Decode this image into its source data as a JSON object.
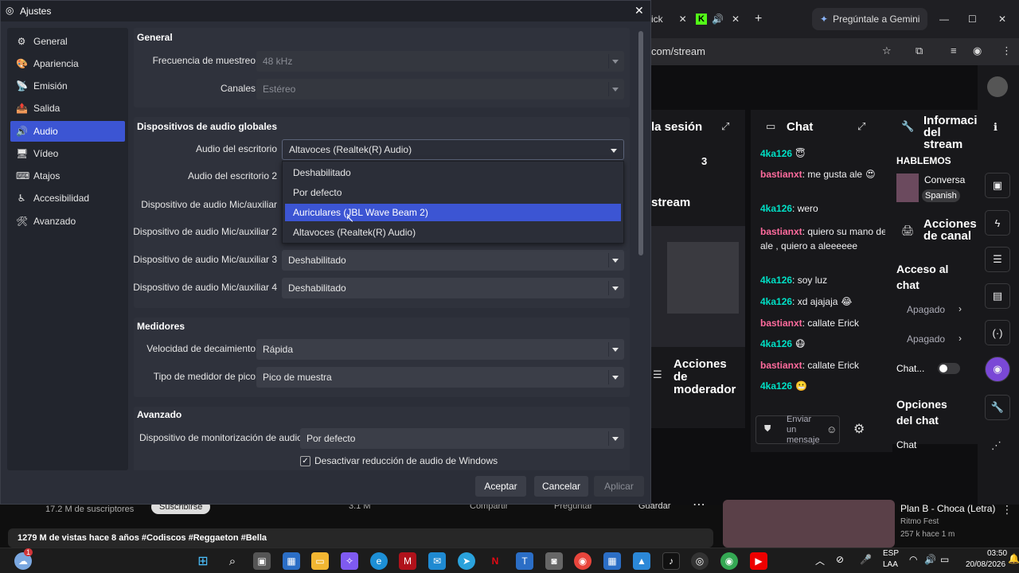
{
  "browser": {
    "tab_partial": "ick",
    "tab_gemini": "Pregúntale a Gemini",
    "address": "com/stream"
  },
  "twitch": {
    "session_title": "la sesión",
    "session_number": "3",
    "stream_label": "stream",
    "mod_actions": "Acciones de moderador",
    "chat_title": "Chat",
    "chat_messages": [
      {
        "user": "4ka126",
        "text": "",
        "emote": "😇"
      },
      {
        "user": "bastianxt",
        "text": ": me gusta ale",
        "emote": "😍"
      },
      {
        "user": "4ka126",
        "text": ": wero",
        "emote": ""
      },
      {
        "user": "bastianxt",
        "text": ": quiero su mano de ale , quiero a aleeeeee",
        "emote": ""
      },
      {
        "user": "4ka126",
        "text": ": soy luz",
        "emote": ""
      },
      {
        "user": "4ka126",
        "text": ": xd ajajaja",
        "emote": "😂"
      },
      {
        "user": "bastianxt",
        "text": ": callate Erick",
        "emote": ""
      },
      {
        "user": "4ka126",
        "text": "",
        "emote": "😷"
      },
      {
        "user": "bastianxt",
        "text": ": callate Erick",
        "emote": ""
      },
      {
        "user": "4ka126",
        "text": "",
        "emote": "😬"
      }
    ],
    "chat_placeholder": "Enviar un mensaje",
    "info_title": "Información del stream",
    "hablemos": "HABLEMOS",
    "conversa": "Conversa",
    "spanish": "Spanish",
    "channel_actions": "Acciones de canal",
    "chat_access": "Acceso al chat",
    "off1": "Apagado",
    "off2": "Apagado",
    "chat_toggle": "Chat...",
    "chat_options": "Opciones del chat",
    "chat_last": "Chat"
  },
  "youtube": {
    "subscribers": "17.2 M de suscriptores",
    "subscribe": "Suscribirse",
    "likes": "3.1 M",
    "share": "Compartir",
    "ask": "Preguntar",
    "save": "Guardar",
    "views": "1279 M de vistas  hace 8 años  #Codiscos #Reggaeton #Bella",
    "next_title": "Plan B - Choca (Letra)",
    "next_channel": "Ritmo Fest",
    "next_meta": "257 k  hace 1 m"
  },
  "taskbar": {
    "lang_top": "ESP",
    "lang_bottom": "LAA",
    "time": "03:50",
    "date": "20/08/2026",
    "badge": "1"
  },
  "dialog": {
    "title": "Ajustes",
    "nav": [
      {
        "label": "General",
        "icon": "⚙"
      },
      {
        "label": "Apariencia",
        "icon": "🎨"
      },
      {
        "label": "Emisión",
        "icon": "📡"
      },
      {
        "label": "Salida",
        "icon": "📤"
      },
      {
        "label": "Audio",
        "icon": "🔊"
      },
      {
        "label": "Vídeo",
        "icon": "🖥"
      },
      {
        "label": "Atajos",
        "icon": "⌨"
      },
      {
        "label": "Accesibilidad",
        "icon": "♿"
      },
      {
        "label": "Avanzado",
        "icon": "🛠"
      }
    ],
    "general": {
      "title": "General",
      "sample_rate_label": "Frecuencia de muestreo",
      "sample_rate_value": "48 kHz",
      "channels_label": "Canales",
      "channels_value": "Estéreo"
    },
    "global_devices": {
      "title": "Dispositivos de audio globales",
      "desktop_label": "Audio del escritorio",
      "desktop_value": "Altavoces (Realtek(R) Audio)",
      "desktop2_label": "Audio del escritorio 2",
      "mic1_label": "Dispositivo de audio Mic/auxiliar",
      "mic2_label": "Dispositivo de audio Mic/auxiliar 2",
      "mic3_label": "Dispositivo de audio Mic/auxiliar 3",
      "mic3_value": "Deshabilitado",
      "mic4_label": "Dispositivo de audio Mic/auxiliar 4",
      "mic4_value": "Deshabilitado"
    },
    "dropdown_options": [
      "Deshabilitado",
      "Por defecto",
      "Auriculares (JBL Wave Beam 2)",
      "Altavoces (Realtek(R) Audio)"
    ],
    "meters": {
      "title": "Medidores",
      "decay_label": "Velocidad de decaimiento",
      "decay_value": "Rápida",
      "peak_label": "Tipo de medidor de pico",
      "peak_value": "Pico de muestra"
    },
    "advanced": {
      "title": "Avanzado",
      "monitor_label": "Dispositivo de monitorización de audio",
      "monitor_value": "Por defecto",
      "ducking_label": "Desactivar reducción de audio de Windows"
    },
    "buttons": {
      "accept": "Aceptar",
      "cancel": "Cancelar",
      "apply": "Aplicar"
    }
  }
}
